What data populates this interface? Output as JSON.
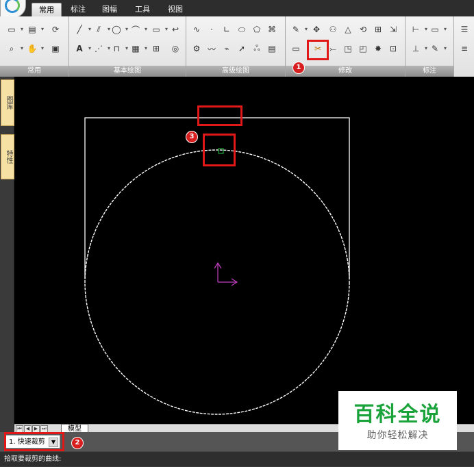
{
  "menu_tabs": [
    "常用",
    "标注",
    "图幅",
    "工具",
    "视图"
  ],
  "ribbon_panels": [
    "常用",
    "基本绘图",
    "高级绘图",
    "修改",
    "标注"
  ],
  "side_tabs": [
    "图库",
    "特性"
  ],
  "model_tab_label": "模型",
  "command_combo": "1. 快速裁剪",
  "status_prompt": "拾取要裁剪的曲线:",
  "annotation_numbers": [
    "1",
    "2",
    "3"
  ],
  "watermark": {
    "title": "百科全说",
    "subtitle": "助你轻松解决"
  },
  "colors": {
    "highlight_red": "#e01818",
    "watermark_green": "#1aa33a",
    "ucs_magenta": "#c040c0"
  }
}
